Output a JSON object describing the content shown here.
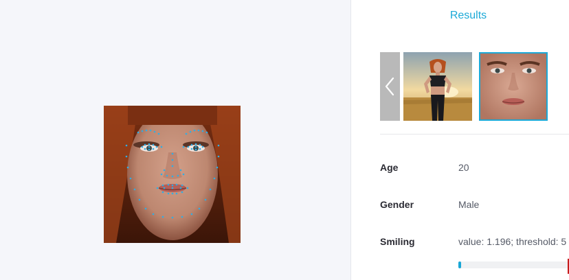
{
  "results_panel": {
    "title": "Results",
    "nav_prev_icon": "chevron-left-icon",
    "thumbnails": [
      {
        "name": "full-photo-thumbnail",
        "selected": false
      },
      {
        "name": "face-crop-thumbnail",
        "selected": true
      }
    ],
    "attributes": {
      "age": {
        "label": "Age",
        "value": "20"
      },
      "gender": {
        "label": "Gender",
        "value": "Male"
      },
      "smiling": {
        "label": "Smiling",
        "value_text": "value: 1.196; threshold: 5",
        "value": 1.196,
        "bar_fraction": 0.012
      }
    }
  },
  "colors": {
    "accent": "#1ba9d7",
    "landmark": "#2eaee6",
    "threshold": "#c51d1d"
  }
}
